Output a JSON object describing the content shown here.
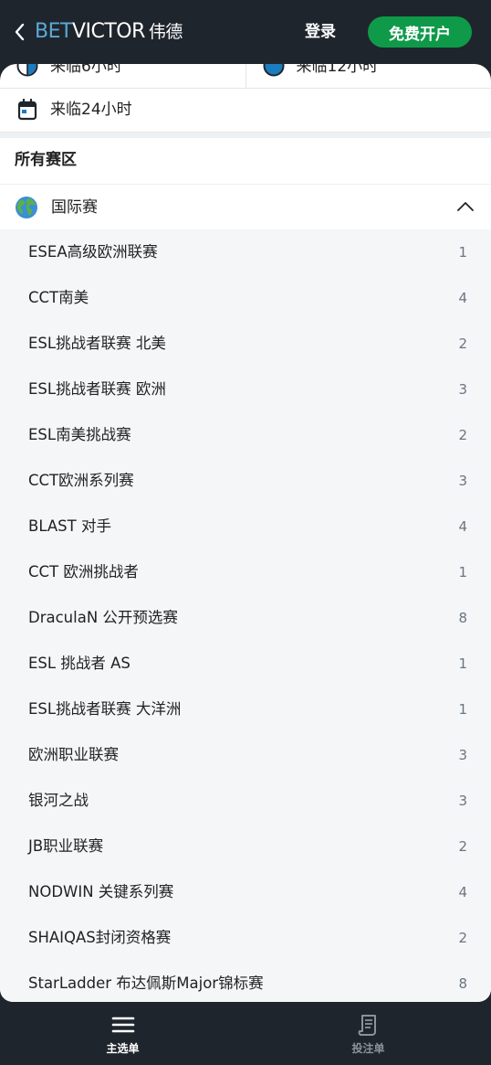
{
  "header": {
    "logo_bet": "BET",
    "logo_victor": "VICTOR",
    "logo_region": "伟德",
    "login_label": "登录",
    "signup_label": "免费开户"
  },
  "quick_filters": [
    {
      "label": "来临6小时",
      "icon": "clock-half-icon"
    },
    {
      "label": "来临12小时",
      "icon": "clock-full-icon"
    }
  ],
  "day_filter": {
    "label": "来临24小时",
    "icon": "calendar-icon"
  },
  "section_title": "所有赛区",
  "region": {
    "label": "国际赛",
    "icon": "globe-icon",
    "expanded": true
  },
  "competitions": [
    {
      "name": "ESEA高级欧洲联赛",
      "count": "1"
    },
    {
      "name": "CCT南美",
      "count": "4"
    },
    {
      "name": "ESL挑战者联赛 北美",
      "count": "2"
    },
    {
      "name": "ESL挑战者联赛 欧洲",
      "count": "3"
    },
    {
      "name": "ESL南美挑战赛",
      "count": "2"
    },
    {
      "name": "CCT欧洲系列赛",
      "count": "3"
    },
    {
      "name": "BLAST 对手",
      "count": "4"
    },
    {
      "name": "CCT 欧洲挑战者",
      "count": "1"
    },
    {
      "name": "DraculaN 公开预选赛",
      "count": "8"
    },
    {
      "name": "ESL 挑战者 AS",
      "count": "1"
    },
    {
      "name": "ESL挑战者联赛 大洋洲",
      "count": "1"
    },
    {
      "name": "欧洲职业联赛",
      "count": "3"
    },
    {
      "name": "银河之战",
      "count": "3"
    },
    {
      "name": "JB职业联赛",
      "count": "2"
    },
    {
      "name": "NODWIN 关键系列赛",
      "count": "4"
    },
    {
      "name": "SHAIQAS封闭资格赛",
      "count": "2"
    },
    {
      "name": "StarLadder 布达佩斯Major锦标赛",
      "count": "8"
    }
  ],
  "bottom_nav": [
    {
      "label": "主选单",
      "icon": "menu-icon",
      "active": true
    },
    {
      "label": "投注单",
      "icon": "betslip-icon",
      "active": false
    }
  ],
  "colors": {
    "header_bg": "#1f252d",
    "signup_bg": "#0f9a49",
    "logo_bet": "#5aa9d6",
    "list_bg": "#f4f6f8"
  }
}
